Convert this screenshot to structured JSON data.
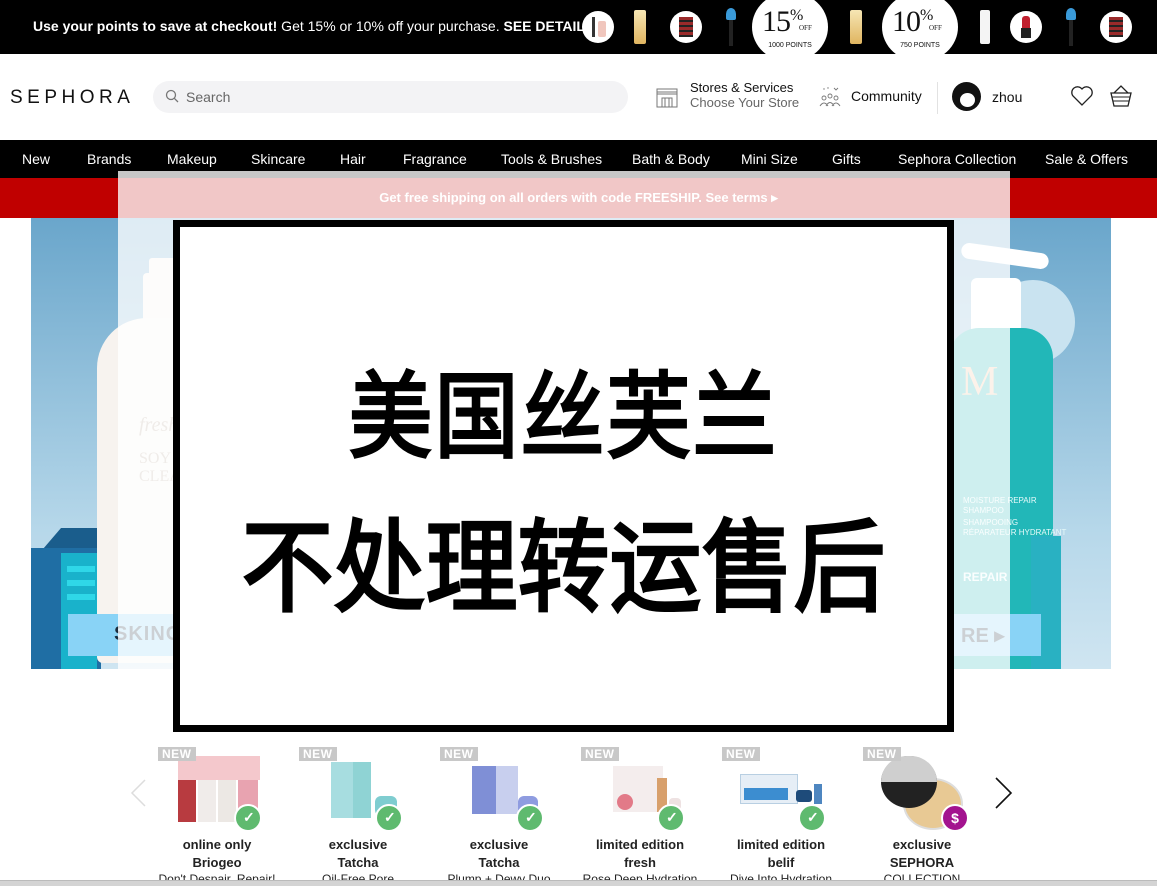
{
  "promo": {
    "bold_text": "Use your points to save at checkout!",
    "text": " Get 15% or 10% off your purchase. ",
    "link": "SEE DETAILS ▸",
    "offers": [
      {
        "percent": "15",
        "off": "OFF",
        "points": "1000 POINTS"
      },
      {
        "percent": "10",
        "off": "OFF",
        "points": "750 POINTS"
      }
    ]
  },
  "header": {
    "logo": "SEPHORA",
    "search_placeholder": "Search",
    "stores_title": "Stores & Services",
    "stores_subtitle": "Choose Your Store",
    "community": "Community",
    "user_name": "zhou"
  },
  "nav": {
    "items": [
      "New",
      "Brands",
      "Makeup",
      "Skincare",
      "Hair",
      "Fragrance",
      "Tools & Brushes",
      "Bath & Body",
      "Mini Size",
      "Gifts",
      "Sephora Collection",
      "Sale & Offers"
    ]
  },
  "shipping": {
    "text": "Get free shipping on all orders with code FREESHIP. See terms ▸"
  },
  "hero": {
    "left_brand": "fresh",
    "left_product_lines": [
      "SOY F",
      "CLEAN"
    ],
    "left_cta": "SKINC",
    "right_product_lines": [
      "MOISTURE REPAIR",
      "SHAMPOO",
      "SHAMPOOING",
      "RÉPARATEUR HYDRATANT"
    ],
    "right_repair": "REPAIR",
    "right_cta": "RE ▸"
  },
  "overlay": {
    "line1": "美国丝芙兰",
    "line2": "不处理转运售后"
  },
  "carousel": {
    "products": [
      {
        "badge": "NEW",
        "tag": "online only",
        "brand": "Briogeo",
        "name": "Don't Despair, Repair!",
        "marker": "clean"
      },
      {
        "badge": "NEW",
        "tag": "exclusive",
        "brand": "Tatcha",
        "name": "Oil-Free Pore",
        "marker": "clean"
      },
      {
        "badge": "NEW",
        "tag": "exclusive",
        "brand": "Tatcha",
        "name": "Plump + Dewy Duo",
        "marker": "clean"
      },
      {
        "badge": "NEW",
        "tag": "limited edition",
        "brand": "fresh",
        "name": "Rose Deep Hydration",
        "marker": "clean"
      },
      {
        "badge": "NEW",
        "tag": "limited edition",
        "brand": "belif",
        "name": "Dive Into Hydration",
        "marker": "clean"
      },
      {
        "badge": "NEW",
        "tag": "exclusive",
        "brand": "SEPHORA",
        "name": "COLLECTION",
        "marker": "value",
        "marker_symbol": "$"
      }
    ]
  },
  "colors": {
    "brand_black": "#000000",
    "shipping_red": "#c00000",
    "clean_badge": "#5fba6f",
    "value_badge": "#a3138f",
    "new_badge": "#c8c8c8"
  }
}
